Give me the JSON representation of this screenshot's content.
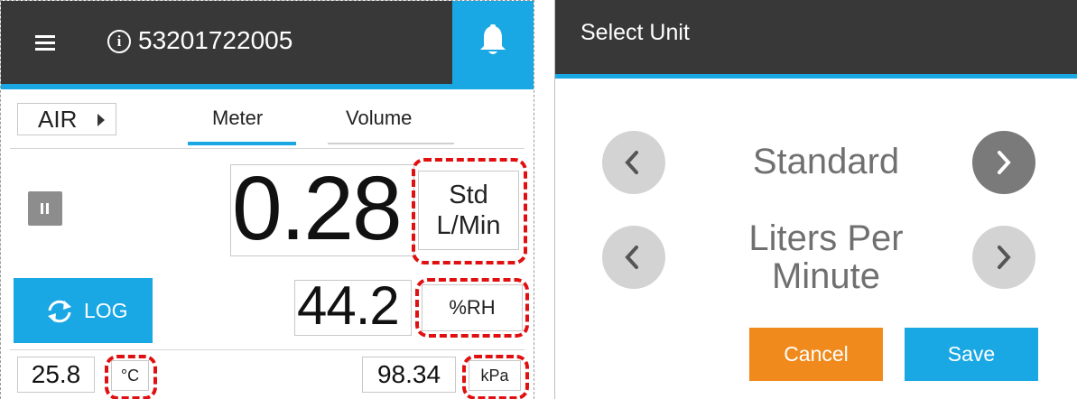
{
  "left": {
    "header": {
      "device_id": "53201722005",
      "info_symbol": "i"
    },
    "gas_selector": {
      "label": "AIR"
    },
    "tabs": [
      {
        "label": "Meter",
        "active": true
      },
      {
        "label": "Volume",
        "active": false
      }
    ],
    "flow": {
      "value": "0.28",
      "unit_line1": "Std",
      "unit_line2": "L/Min"
    },
    "log_button": {
      "label": "LOG"
    },
    "humidity": {
      "value": "44.2",
      "unit": "%RH"
    },
    "temperature": {
      "value": "25.8",
      "unit": "°C"
    },
    "pressure": {
      "value": "98.34",
      "unit": "kPa"
    }
  },
  "dialog": {
    "title": "Select Unit",
    "options": [
      {
        "label": "Standard"
      },
      {
        "label_line1": "Liters Per",
        "label_line2": "Minute"
      }
    ],
    "cancel_label": "Cancel",
    "save_label": "Save"
  },
  "colors": {
    "accent": "#1aa8e4",
    "header": "#383838",
    "cancel": "#f08a1c",
    "highlight": "#e01010"
  }
}
